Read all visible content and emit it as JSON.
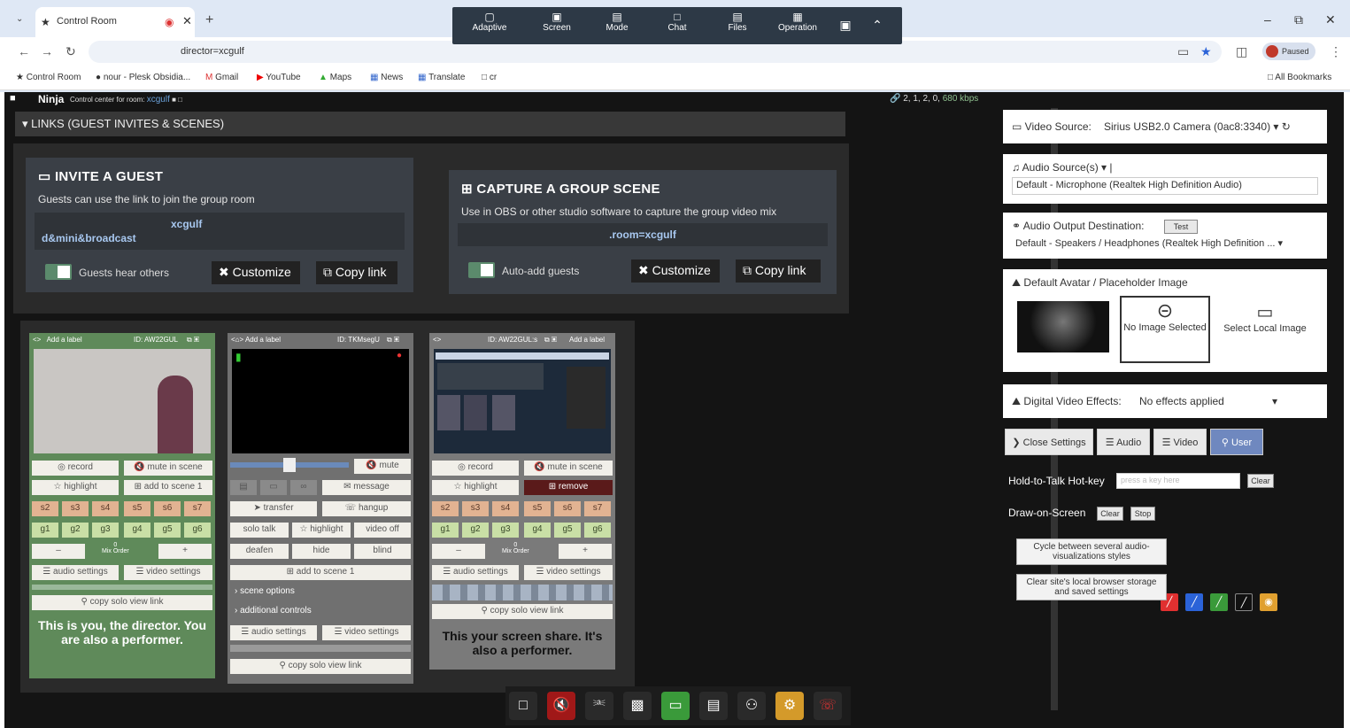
{
  "browser": {
    "tab_title": "Control Room",
    "url": "director=xcgulf",
    "profile": "Paused",
    "bookmarks": [
      {
        "label": "Control Room"
      },
      {
        "label": "nour - Plesk Obsidia..."
      },
      {
        "label": "Gmail"
      },
      {
        "label": "YouTube"
      },
      {
        "label": "Maps"
      },
      {
        "label": "News"
      },
      {
        "label": "Translate"
      },
      {
        "label": "cr"
      }
    ],
    "all_bookmarks": "All Bookmarks"
  },
  "share_toolbar": {
    "items": [
      {
        "label": "Adaptive"
      },
      {
        "label": "Screen"
      },
      {
        "label": "Mode"
      },
      {
        "label": "Chat"
      },
      {
        "label": "Files"
      },
      {
        "label": "Operation"
      }
    ]
  },
  "app": {
    "brand": "Ninja",
    "brand_sub": "Control center for room:",
    "room": "xcgulf",
    "stats": "2, 1, 2, 0,",
    "kbps": "680 kbps",
    "links_header": "LINKS (GUEST INVITES & SCENES)"
  },
  "invite": {
    "title": "INVITE A GUEST",
    "desc": "Guests can use the link to join the group room",
    "link_room": "xcgulf",
    "link_tail": "d&mini&broadcast",
    "toggle_label": "Guests hear others",
    "customize": "Customize",
    "copy": "Copy link"
  },
  "scene": {
    "title": "CAPTURE A GROUP SCENE",
    "desc": "Use in OBS or other studio software to capture the group video mix",
    "link": ".room=xcgulf",
    "toggle_label": "Auto-add guests",
    "customize": "Customize",
    "copy": "Copy link"
  },
  "cards": [
    {
      "label": "Add a label",
      "id": "ID: AW22GUL",
      "record": "record",
      "mute_scene": "mute in scene",
      "highlight": "highlight",
      "add_scene": "add to scene 1",
      "scenes": [
        "s2",
        "s3",
        "s4",
        "s5",
        "s6",
        "s7"
      ],
      "groups": [
        "g1",
        "g2",
        "g3",
        "g4",
        "g5",
        "g6"
      ],
      "mix_order": "Mix Order",
      "audio_settings": "audio settings",
      "video_settings": "video settings",
      "solo": "copy solo view link",
      "footer": "This is you, the director. You are also a performer."
    },
    {
      "label": "Add a label",
      "id": "ID: TKMsegU",
      "mute": "mute",
      "message": "message",
      "transfer": "transfer",
      "hangup": "hangup",
      "solo_talk": "solo talk",
      "highlight": "highlight",
      "video_off": "video off",
      "deafen": "deafen",
      "hide": "hide",
      "blind": "blind",
      "add_scene": "add to scene 1",
      "scene_options": "scene options",
      "additional": "additional controls",
      "audio_settings": "audio settings",
      "video_settings": "video settings",
      "solo": "copy solo view link"
    },
    {
      "label": "Add a label",
      "id": "ID: AW22GUL:s",
      "record": "record",
      "mute_scene": "mute in scene",
      "highlight": "highlight",
      "remove": "remove",
      "scenes": [
        "s2",
        "s3",
        "s4",
        "s5",
        "s6",
        "s7"
      ],
      "groups": [
        "g1",
        "g2",
        "g3",
        "g4",
        "g5",
        "g6"
      ],
      "mix_order": "Mix Order",
      "audio_settings": "audio settings",
      "video_settings": "video settings",
      "solo": "copy solo view link",
      "footer": "This your screen share. It's also a performer."
    }
  ],
  "settings": {
    "video_source_label": "Video Source:",
    "video_source_value": "Sirius USB2.0 Camera (0ac8:3340)",
    "audio_sources_label": "Audio Source(s)",
    "audio_source_value": "Default - Microphone (Realtek High Definition Audio)",
    "audio_output_label": "Audio Output Destination:",
    "test": "Test",
    "audio_output_value": "Default - Speakers / Headphones (Realtek High Definition ...",
    "avatar_label": "Default Avatar / Placeholder Image",
    "no_image": "No Image Selected",
    "select_local": "Select Local Image",
    "dve_label": "Digital Video Effects:",
    "dve_value": "No effects applied",
    "close_settings": "Close Settings",
    "audio_btn": "Audio",
    "video_btn": "Video",
    "user_btn": "User",
    "hotkey_label": "Hold-to-Talk Hot-key",
    "hotkey_placeholder": "press a key here",
    "clear": "Clear",
    "draw_label": "Draw-on-Screen",
    "draw_clear": "Clear",
    "draw_stop": "Stop",
    "cycle": "Cycle between several audio-visualizations styles",
    "clear_storage": "Clear site's local browser storage and saved settings"
  },
  "colors": {
    "red": "#e03030",
    "blue": "#2b63d8",
    "green": "#3a9a3a",
    "black": "#111111",
    "orange": "#e0a030"
  }
}
